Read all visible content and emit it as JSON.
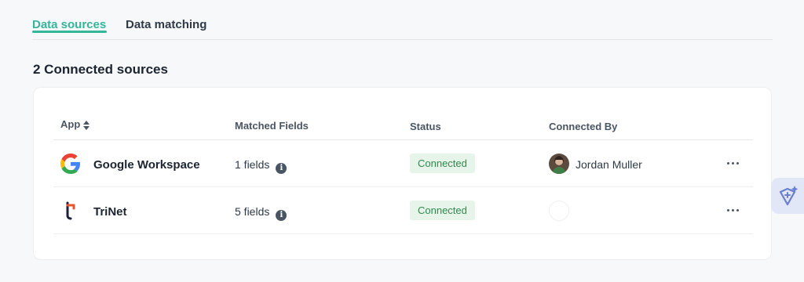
{
  "tabs": [
    {
      "label": "Data sources",
      "active": true
    },
    {
      "label": "Data matching",
      "active": false
    }
  ],
  "section_title": "2 Connected sources",
  "table": {
    "columns": [
      "App",
      "Matched Fields",
      "Status",
      "Connected By"
    ],
    "rows": [
      {
        "app": "Google Workspace",
        "app_icon": "google-logo-icon",
        "fields": "1 fields",
        "status": "Connected",
        "connected_by": "Jordan Muller"
      },
      {
        "app": "TriNet",
        "app_icon": "trinet-logo-icon",
        "fields": "5 fields",
        "status": "Connected",
        "connected_by": ""
      }
    ]
  },
  "colors": {
    "accent": "#35b59a",
    "status_bg": "#e6f4ea",
    "status_text": "#2f8a4f"
  }
}
